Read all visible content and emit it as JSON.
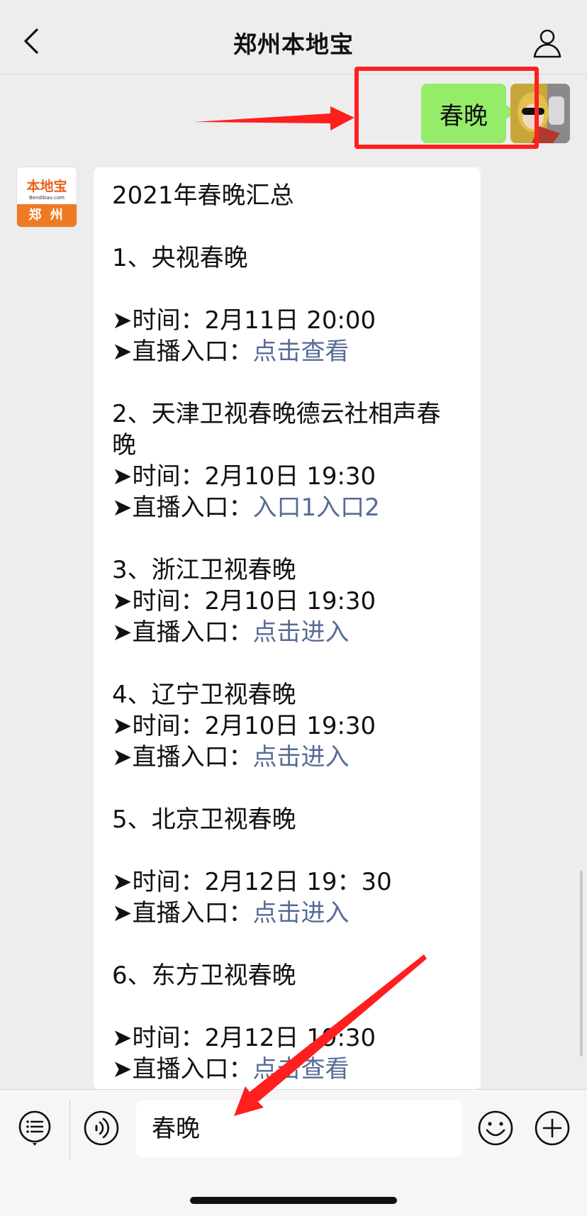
{
  "header": {
    "title": "郑州本地宝",
    "back_icon": "chevron-left-icon",
    "profile_icon": "person-icon"
  },
  "outgoing": {
    "text": "春晚",
    "bubble_color": "#95ec69"
  },
  "bot": {
    "avatar_brand": "本地宝",
    "avatar_domain": "Bendibao.com",
    "avatar_city": "郑 州",
    "brand_color": "#ee7a23"
  },
  "message": {
    "title": "2021年春晚汇总",
    "sections": [
      {
        "heading": "1、央视春晚",
        "time": "➤时间：2月11日 20:00",
        "entry_label": "➤直播入口：",
        "entry_link": "点击查看"
      },
      {
        "heading": "2、天津卫视春晚德云社相声春晚",
        "time": "➤时间：2月10日 19:30",
        "entry_label": "➤直播入口：",
        "entry_link": "入口1入口2"
      },
      {
        "heading": "3、浙江卫视春晚",
        "time": "➤时间：2月10日 19:30",
        "entry_label": "➤直播入口：",
        "entry_link": "点击进入"
      },
      {
        "heading": "4、辽宁卫视春晚",
        "time": "➤时间：2月10日 19:30",
        "entry_label": "➤直播入口：",
        "entry_link": "点击进入"
      },
      {
        "heading": "5、北京卫视春晚",
        "time": "➤时间：2月12日 19：30",
        "entry_label": "➤直播入口：",
        "entry_link": "点击进入"
      },
      {
        "heading": "6、东方卫视春晚",
        "time": "➤时间：2月12日 19:30",
        "entry_label": "➤直播入口：",
        "entry_link": "点击查看"
      }
    ],
    "link_color": "#576b95"
  },
  "input_bar": {
    "value": "春晚",
    "menu_icon": "menu-list-icon",
    "voice_icon": "voice-icon",
    "emoji_icon": "emoji-icon",
    "plus_icon": "plus-icon"
  },
  "annotation_color": "#ff1f1f"
}
